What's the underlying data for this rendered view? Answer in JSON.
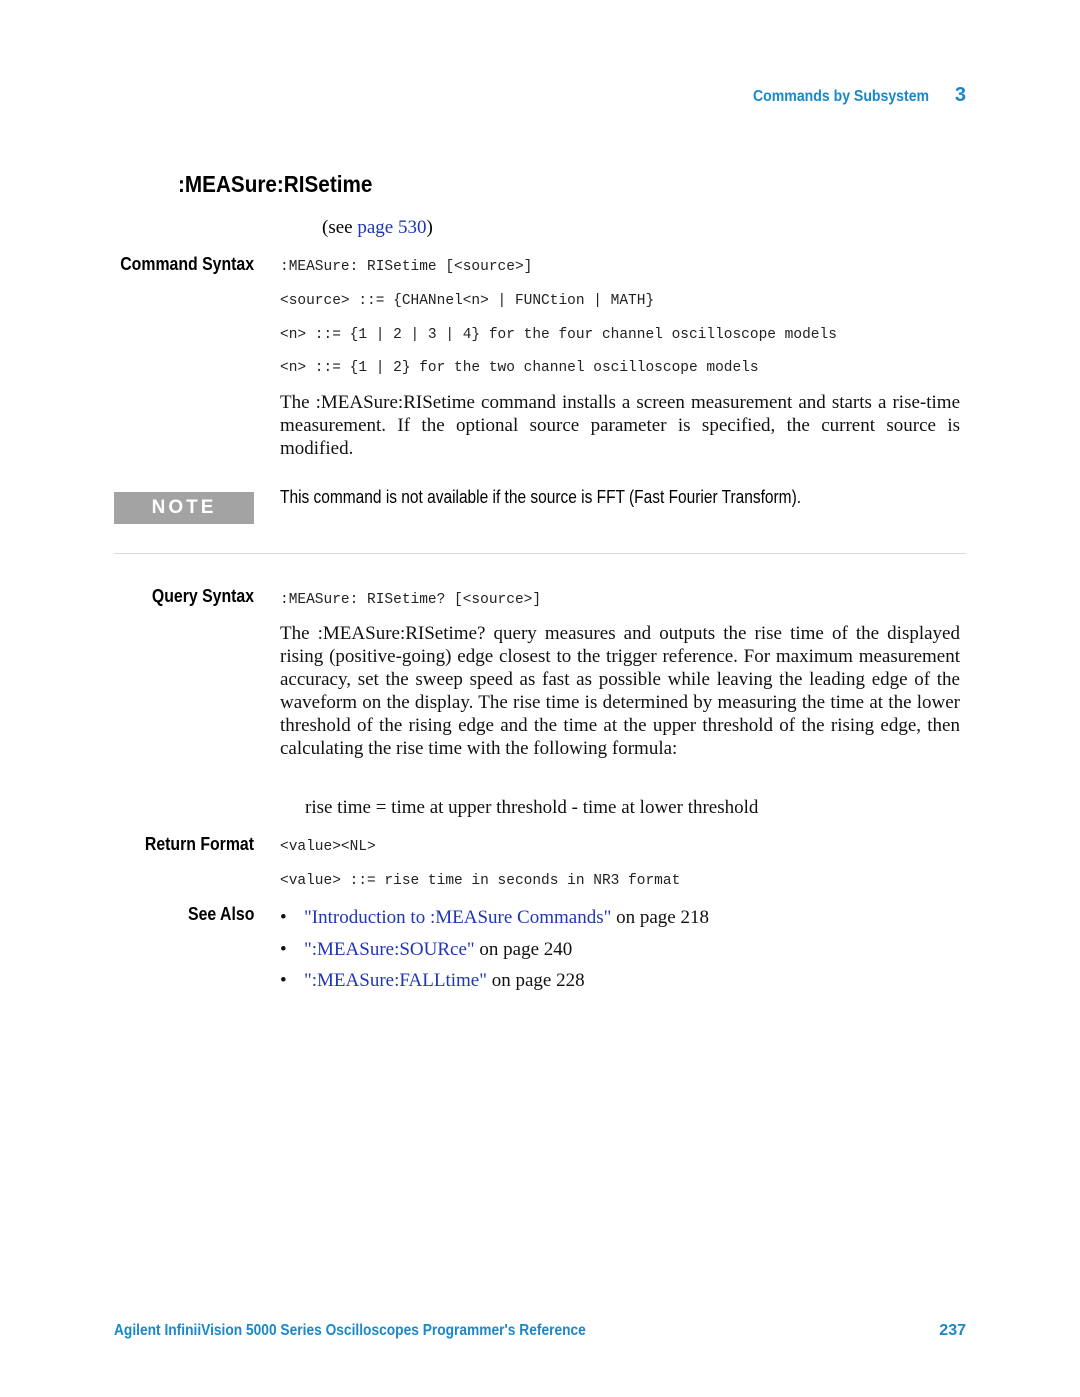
{
  "header": {
    "section": "Commands by Subsystem",
    "chapter": "3"
  },
  "command": {
    "title": ":MEASure:RISetime",
    "see_prefix": "(see ",
    "see_link": "page 530",
    "see_suffix": ")"
  },
  "command_syntax": {
    "label": "Command Syntax",
    "lines": [
      ":MEASure: RISetime [<source>]",
      "<source> ::= {CHANnel<n> | FUNCtion | MATH}",
      "<n> ::= {1 | 2 | 3 | 4} for the four channel oscilloscope models",
      "<n> ::= {1 | 2} for the two channel oscilloscope models"
    ],
    "description": "The :MEASure:RISetime command installs a screen measurement and starts a rise-time measurement. If the optional source parameter is specified, the current source is modified."
  },
  "note": {
    "label": "NOTE",
    "text": "This command is not available if the source is FFT (Fast Fourier Transform)."
  },
  "query_syntax": {
    "label": "Query Syntax",
    "line": ":MEASure: RISetime? [<source>]",
    "description": "The :MEASure:RISetime? query measures and outputs the rise time of the displayed rising (positive-going) edge closest to the trigger reference. For maximum measurement accuracy, set the sweep speed as fast as possible while leaving the leading edge of the waveform on the display. The rise time is determined by measuring the time at the lower threshold of the rising edge and the time at the upper threshold of the rising edge, then calculating the rise time with the following formula:",
    "formula": "rise time = time at upper threshold - time at lower threshold"
  },
  "return_format": {
    "label": "Return Format",
    "lines": [
      "<value><NL>",
      "<value> ::= rise time in seconds in NR3 format"
    ]
  },
  "see_also": {
    "label": "See Also",
    "items": [
      {
        "link": "\"Introduction to :MEASure Commands\"",
        "suffix": " on page 218"
      },
      {
        "link": "\":MEASure:SOURce\"",
        "suffix": " on page 240"
      },
      {
        "link": "\":MEASure:FALLtime\"",
        "suffix": " on page 228"
      }
    ]
  },
  "footer": {
    "title": "Agilent InfiniiVision 5000 Series Oscilloscopes Programmer's Reference",
    "page": "237"
  }
}
